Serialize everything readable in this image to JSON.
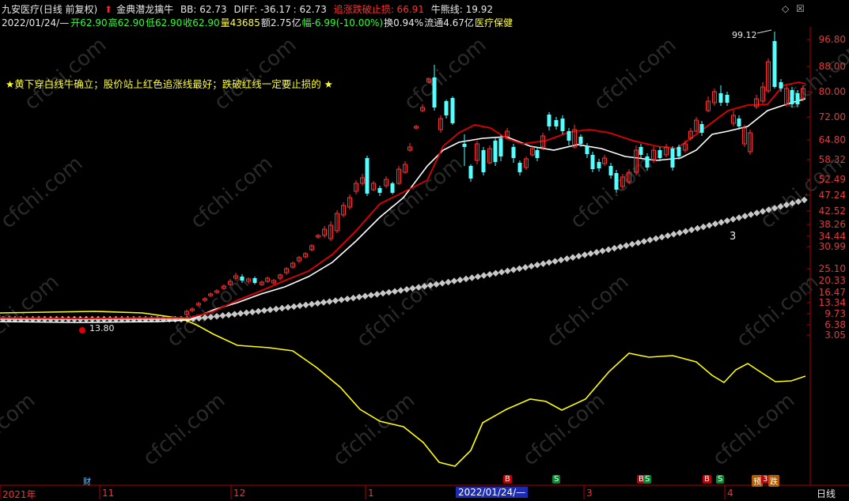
{
  "header": {
    "stock_name": "九安医疗",
    "mode": "(日线 前复权)",
    "formula_name": "金典潜龙擒牛",
    "bb": "BB: 62.73",
    "diff": "DIFF: -36.17",
    "diff_val": ": 62.73",
    "red_label": "追涨跌破止损: 66.91",
    "bull_line": "牛熊线: 19.92"
  },
  "quote": {
    "date": "2022/01/24/—",
    "open": "开62.90",
    "high": "高62.90",
    "low": "低62.90",
    "close": "收62.90",
    "volume": "量43685",
    "amount": "额2.75亿",
    "change": "幅-6.99(-10.00%)",
    "turnover": "换0.94%",
    "float": "流通4.67亿",
    "sector": "医疗保健"
  },
  "note": "★黄下穿白线牛确立；股价站上红色追涨线最好；跌破红线一定要止损的 ★",
  "annotations": {
    "peak": "99.12",
    "low": "13.80",
    "count": "3"
  },
  "y_axis": [
    "96.80",
    "88.00",
    "80.00",
    "72.00",
    "64.80",
    "58.32",
    "52.49",
    "47.24",
    "42.52",
    "38.26",
    "34.44",
    "30.99",
    "25.10",
    "20.33",
    "16.47",
    "13.34",
    "9.73",
    "6.38",
    "3.05"
  ],
  "x_axis": [
    {
      "label": "2021年",
      "pos": 0
    },
    {
      "label": "11",
      "pos": 126
    },
    {
      "label": "12",
      "pos": 292
    },
    {
      "label": "1",
      "pos": 462
    },
    {
      "label": "3",
      "pos": 738
    },
    {
      "label": "4",
      "pos": 916
    }
  ],
  "cursor_date": "2022/01/24/—",
  "period": "日线",
  "signals": [
    {
      "label": "财",
      "kind": "cai",
      "pos": 103
    },
    {
      "label": "B",
      "kind": "buy",
      "pos": 636
    },
    {
      "label": "S",
      "kind": "sell",
      "pos": 698
    },
    {
      "label": "B",
      "kind": "buy",
      "pos": 805
    },
    {
      "label": "S",
      "kind": "sell",
      "pos": 813
    },
    {
      "label": "B",
      "kind": "buy",
      "pos": 888
    },
    {
      "label": "S",
      "kind": "sell",
      "pos": 905
    },
    {
      "label": "预",
      "kind": "pre",
      "pos": 950
    },
    {
      "label": "3",
      "kind": "buy",
      "pos": 962
    },
    {
      "label": "跌",
      "kind": "pre",
      "pos": 971
    }
  ],
  "colors": {
    "up": "#ff3030",
    "down": "#54ffff",
    "red": "#e00000",
    "white": "#ffffff",
    "yellow": "#ffff00",
    "dots": "#c8c8c8",
    "axis": "#b00000",
    "grid": "#5a0000"
  },
  "watermark": "cfchi.com"
}
